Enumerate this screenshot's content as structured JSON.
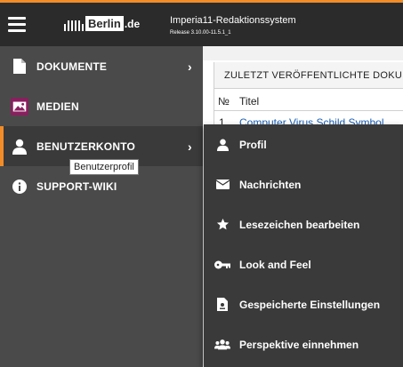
{
  "header": {
    "menu_icon": "hamburger-icon",
    "logo_text": "Berlin",
    "logo_tld": ".de",
    "app_title": "Imperia11-Redaktionssystem",
    "release": "Release 3.10.00-11.5.1_1",
    "accent_color": "#f28c28"
  },
  "sidebar": {
    "items": [
      {
        "label": "DOKUMENTE",
        "icon": "document-icon"
      },
      {
        "label": "MEDIEN",
        "icon": "image-icon"
      },
      {
        "label": "BENUTZERKONTO",
        "icon": "user-icon"
      },
      {
        "label": "SUPPORT-WIKI",
        "icon": "info-icon"
      }
    ],
    "tooltip": "Benutzerprofil"
  },
  "main": {
    "panel_title": "ZULETZT VERÖFFENTLICHTE DOKUM",
    "columns": [
      "№",
      "Titel"
    ],
    "rows": [
      {
        "no": "1",
        "title": "Computer Virus Schild Symbol"
      }
    ]
  },
  "dropdown": {
    "items": [
      {
        "label": "Profil",
        "icon": "user-icon"
      },
      {
        "label": "Nachrichten",
        "icon": "envelope-icon"
      },
      {
        "label": "Lesezeichen bearbeiten",
        "icon": "star-icon"
      },
      {
        "label": "Look and Feel",
        "icon": "key-icon"
      },
      {
        "label": "Gespeicherte Einstellungen",
        "icon": "settings-file-icon"
      },
      {
        "label": "Perspektive einnehmen",
        "icon": "users-icon"
      }
    ]
  }
}
